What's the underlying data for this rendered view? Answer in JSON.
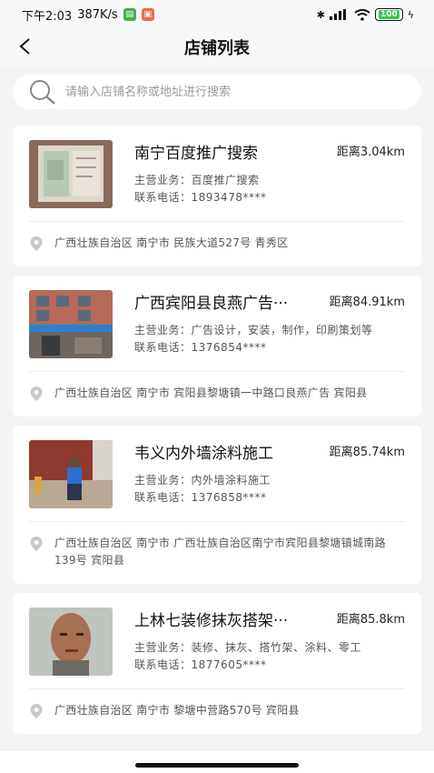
{
  "status_bar": {
    "time": "下午2:03",
    "net_speed": "387K/s",
    "battery": "100"
  },
  "header": {
    "title": "店铺列表"
  },
  "search": {
    "placeholder": "请输入店铺名称或地址进行搜索"
  },
  "shops": [
    {
      "name": "南宁百度推广搜索",
      "distance": "距离3.04km",
      "business_label": "主营业务：",
      "business": "百度推广搜索",
      "phone_label": "联系电话：",
      "phone": "1893478****",
      "address": "广西壮族自治区 南宁市 民族大道527号 青秀区"
    },
    {
      "name": "广西宾阳县良燕广告···",
      "distance": "距离84.91km",
      "business_label": "主营业务：",
      "business": "广告设计，安装，制作，印刷策划等",
      "phone_label": "联系电话：",
      "phone": "1376854****",
      "address": "广西壮族自治区 南宁市 宾阳县黎塘镇一中路口良燕广告 宾阳县"
    },
    {
      "name": "韦义内外墙涂料施工",
      "distance": "距离85.74km",
      "business_label": "主营业务：",
      "business": "内外墙涂料施工",
      "phone_label": "联系电话：",
      "phone": "1376858****",
      "address": "广西壮族自治区 南宁市 广西壮族自治区南宁市宾阳县黎塘镇城南路139号 宾阳县"
    },
    {
      "name": "上林七装修抹灰搭架···",
      "distance": "距离85.8km",
      "business_label": "主营业务：",
      "business": "装修、抹灰、搭竹架、涂料、零工",
      "phone_label": "联系电话：",
      "phone": "1877605****",
      "address": "广西壮族自治区 南宁市 黎塘中营路570号 宾阳县"
    }
  ]
}
